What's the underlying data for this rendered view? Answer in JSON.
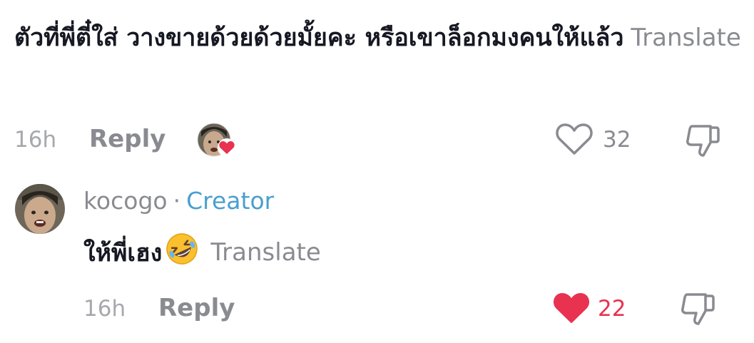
{
  "comment": {
    "text": "ตัวที่พี่ตี๋ใส่ วางขายด้วยด้วยมั้ยคะ หรือเขาล็อกมงคนให้แล้ว",
    "translate_label": "Translate",
    "time": "16h",
    "reply_label": "Reply",
    "likes": "32"
  },
  "creator_reply": {
    "username": "kocogo",
    "separator": "·",
    "badge": "Creator",
    "text": "ให้พี่เฮง",
    "emoji": "rolling-on-floor-laughing",
    "translate_label": "Translate",
    "time": "16h",
    "reply_label": "Reply",
    "likes": "22",
    "liked": true
  },
  "colors": {
    "primary_text": "#161823",
    "secondary_text": "#8a8b91",
    "creator_badge": "#4a9fce",
    "like_red": "#e8324f"
  }
}
